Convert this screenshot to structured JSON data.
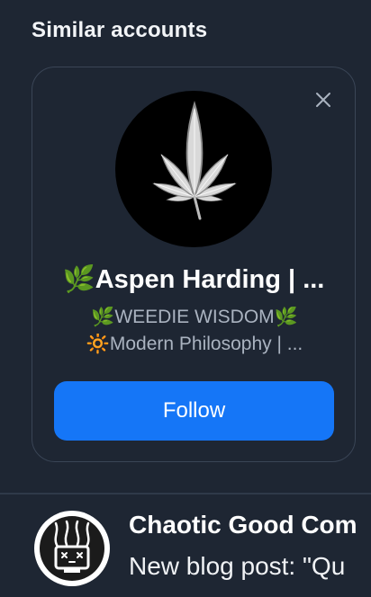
{
  "section": {
    "title": "Similar accounts"
  },
  "suggestion": {
    "name": "🌿Aspen Harding | ...",
    "bio_line1": "🌿WEEDIE WISDOM🌿",
    "bio_line2": "🔆Modern Philosophy | ...",
    "follow_label": "Follow",
    "avatar_icon": "cannabis-leaf-icon",
    "dismiss_icon": "close-icon"
  },
  "feed_item": {
    "author": "Chaotic Good Com",
    "text": "New blog post: \"Qu",
    "avatar_icon": "chaotic-computer-icon"
  },
  "colors": {
    "background": "#1e2633",
    "card_border": "#3a4556",
    "accent": "#1576f7",
    "muted_text": "#aab3c0"
  }
}
